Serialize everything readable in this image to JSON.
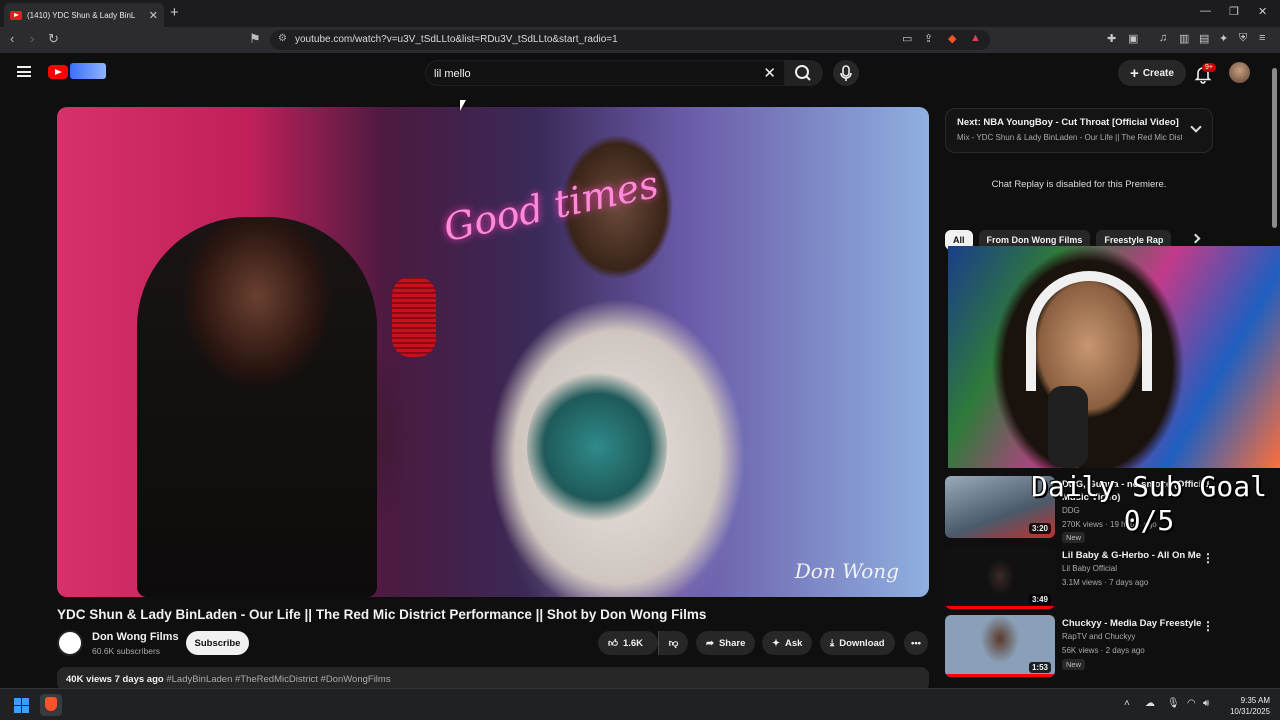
{
  "browser": {
    "tab_title": "(1410) YDC Shun & Lady BinL",
    "url": "youtube.com/watch?v=u3V_tSdLLto&list=RDu3V_tSdLLto&start_radio=1",
    "accent": "#fb542b"
  },
  "yt_header": {
    "search_value": "lil mello",
    "create_label": "Create",
    "notif_badge": "9+"
  },
  "video": {
    "title": "YDC Shun & Lady BinLaden - Our Life || The Red Mic District Performance || Shot by Don Wong Films",
    "neon_sign": "Good times",
    "watermark": "Don Wong"
  },
  "channel": {
    "name": "Don Wong Films",
    "subs": "60.6K subscribers",
    "subscribe_label": "Subscribe"
  },
  "actions": {
    "likes": "1.6K",
    "share": "Share",
    "ask": "Ask",
    "download": "Download"
  },
  "description": {
    "meta": "40K views  7 days ago",
    "tags": "#LadyBinLaden #TheRedMicDistrict #DonWongFilms"
  },
  "up_next": {
    "next": "Next: NBA YoungBoy - Cut Throat [Official Video]",
    "mix": "Mix - YDC Shun & Lady BinLaden - Our Life || The Red Mic District"
  },
  "chat_replay": "Chat Replay is disabled for this Premiere.",
  "chips": [
    "All",
    "From Don Wong Films",
    "Freestyle Rap"
  ],
  "overlay": {
    "line1": "Daily Sub Goal",
    "line2": "0/5"
  },
  "recommendations": [
    {
      "title": "DDG, Gunna - no smoke (Official Music Video)",
      "channel": "DDG",
      "views": "270K views · 19 hours ago",
      "duration": "3:20",
      "new": "New",
      "thumb_color": "#6a7a8a"
    },
    {
      "title": "Lil Baby & G-Herbo - All On Me",
      "channel": "Lil Baby Official",
      "views": "3.1M views · 7 days ago",
      "duration": "3:49",
      "new": "",
      "thumb_color": "#1a1a22"
    },
    {
      "title": "Chuckyy - Media Day Freestyle",
      "channel": "RapTV and Chuckyy",
      "views": "56K views · 2 days ago",
      "duration": "1:53",
      "new": "New",
      "thumb_color": "#8a9ab0"
    }
  ],
  "taskbar": {
    "time": "9:35 AM",
    "date": "10/31/2025"
  }
}
